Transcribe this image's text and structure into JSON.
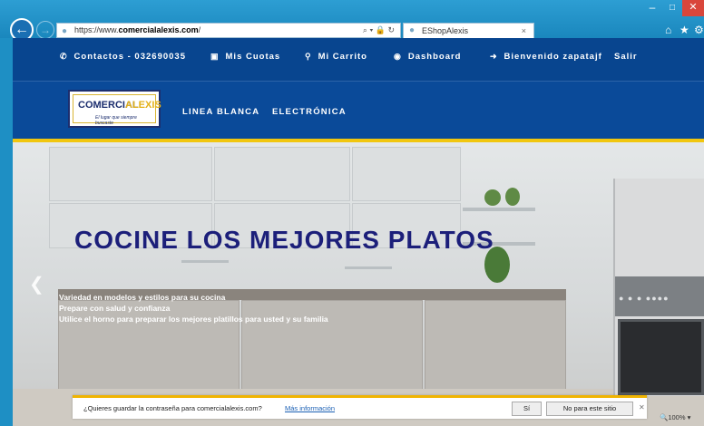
{
  "browser": {
    "url_prefix": "https://www.",
    "url_domain": "comercialalexis.com",
    "url_suffix": "/",
    "url_tools": "⌕ ▾ 🔒 ↻",
    "tab_title": "EShopAlexis",
    "tab_close": "×",
    "zoom": "🔍100%  ▾"
  },
  "topbar": {
    "contact": "Contactos - 032690035",
    "quotas": "Mis Cuotas",
    "cart": "Mi Carrito",
    "dashboard": "Dashboard",
    "welcome": "Bienvenido zapatajf",
    "logout": "Salir"
  },
  "logo": {
    "brand1": "COMERCIAL",
    "brand2": "ALEXIS",
    "slogan": "El lugar que siempre buscaste"
  },
  "nav": {
    "linea_blanca": "LINEA BLANCA",
    "electronica": "ELECTRÓNICA"
  },
  "hero": {
    "title": "COCINE LOS MEJORES PLATOS",
    "line1": "Variedad en modelos y estilos para su cocina",
    "line2": "Prepare con salud y confianza",
    "line3": "Utilice el horno para preparar los mejores platillos para usted y su familia"
  },
  "passbar": {
    "message": "¿Quieres guardar la contraseña para comercialalexis.com?",
    "more_info": "Más información",
    "yes": "Sí",
    "no": "No para este sitio"
  },
  "colors": {
    "topbar": "#08458f",
    "accent_yellow": "#f1c60f",
    "hero_title": "#1c1f7a"
  }
}
